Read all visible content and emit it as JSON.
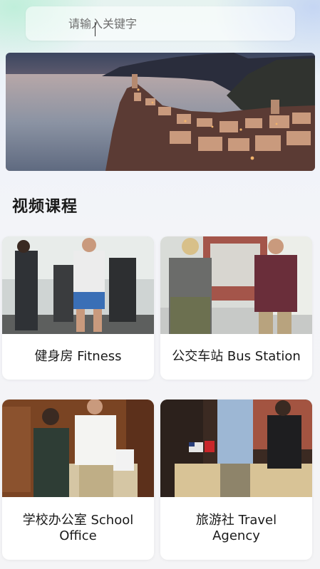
{
  "search": {
    "placeholder": "请输入关键字"
  },
  "banner": {
    "image": "coastal-village-sunset",
    "slide_indicator": "active"
  },
  "section": {
    "title": "视频课程"
  },
  "courses": [
    {
      "label": "健身房 Fitness",
      "thumbnail": "gym-scene"
    },
    {
      "label": "公交车站 Bus Station",
      "thumbnail": "bus-stop-scene"
    },
    {
      "label": "学校办公室 School Office",
      "thumbnail": "school-office-scene"
    },
    {
      "label": "旅游社 Travel Agency",
      "thumbnail": "travel-agency-scene"
    }
  ],
  "colors": {
    "background": "#f4f4f6",
    "card": "#ffffff",
    "text": "#1a1a1a"
  }
}
